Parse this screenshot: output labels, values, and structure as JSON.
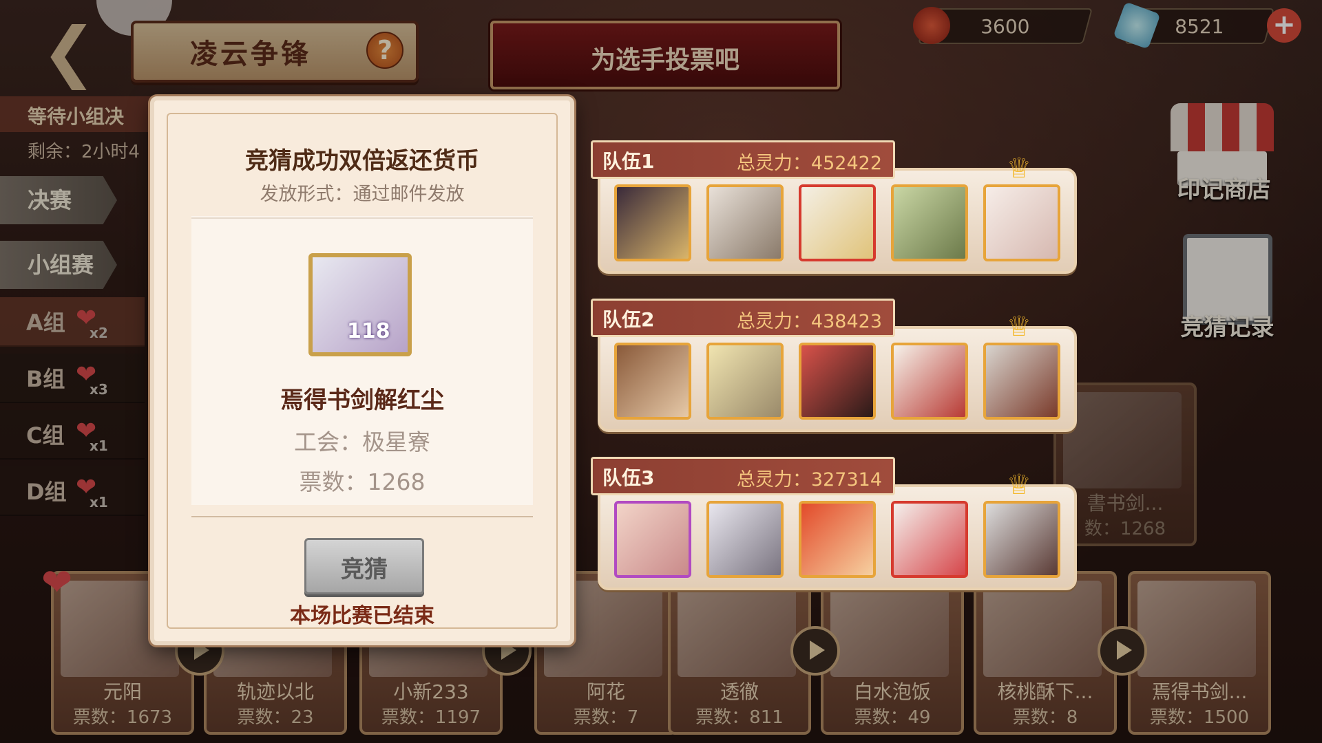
{
  "header": {
    "page_title": "凌云争锋",
    "help": "?",
    "vote_banner": "为选手投票吧",
    "currency": [
      {
        "name": "seal-coin-icon",
        "value": "3600"
      },
      {
        "name": "crystal-icon",
        "value": "8521"
      }
    ]
  },
  "left_panel": {
    "status": "等待小组决",
    "remaining": "剩余：2小时4",
    "tabs": [
      "决赛",
      "小组赛"
    ],
    "groups": [
      {
        "name": "A组",
        "count": "x2"
      },
      {
        "name": "B组",
        "count": "x3"
      },
      {
        "name": "C组",
        "count": "x1"
      },
      {
        "name": "D组",
        "count": "x1"
      }
    ]
  },
  "right_panel": {
    "shop_label": "印记商店",
    "record_label": "竞猜记录"
  },
  "background_card": {
    "name": "書书剑...",
    "votes": "数：1268"
  },
  "teams": [
    {
      "name": "队伍1",
      "power": "总灵力：452422"
    },
    {
      "name": "队伍2",
      "power": "总灵力：438423"
    },
    {
      "name": "队伍3",
      "power": "总灵力：327314"
    }
  ],
  "modal": {
    "heading": "竞猜成功双倍返还货币",
    "subheading": "发放形式：通过邮件发放",
    "level": "118",
    "player_name": "焉得书剑解红尘",
    "guild": "工会：极星寮",
    "votes": "票数：1268",
    "bet_button": "竞猜",
    "ended": "本场比赛已结束"
  },
  "players": [
    {
      "name": "元阳",
      "votes": "票数：1673"
    },
    {
      "name": "轨迹以北",
      "votes": "票数：23"
    },
    {
      "name": "小新233",
      "votes": "票数：1197"
    },
    {
      "name": "阿花",
      "votes": "票数：7"
    },
    {
      "name": "透徹",
      "votes": "票数：811"
    },
    {
      "name": "白水泡饭",
      "votes": "票数：49"
    },
    {
      "name": "核桃酥下...",
      "votes": "票数：8"
    },
    {
      "name": "焉得书剑...",
      "votes": "票数：1500"
    }
  ],
  "colors": {
    "accent_gold": "#e7a43a",
    "team_header": "#8d3f32",
    "heart": "#d6484a"
  }
}
